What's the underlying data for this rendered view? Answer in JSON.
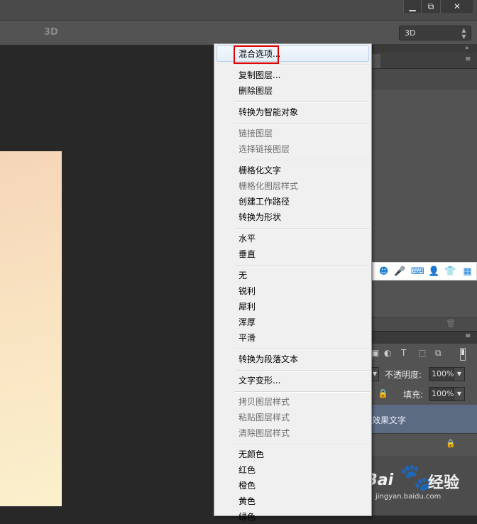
{
  "window": {
    "minimize_label": "▁",
    "restore_label": "⧉",
    "close_label": "✕"
  },
  "options_bar": {
    "mode_3d_label": "3D",
    "select_3d_value": "3D",
    "select_arrows": "▲▼"
  },
  "panels": {
    "collapse_glyph": "»",
    "menu_glyph": "≡",
    "trash_icon": "🗑"
  },
  "ime_toolbar": {
    "icons": [
      "smile-icon",
      "mic-icon",
      "keyboard-icon",
      "user-icon",
      "shirt-icon",
      "grid-icon"
    ]
  },
  "layers": {
    "tool_glyphs": [
      "▣",
      "◐",
      "T",
      "⬚",
      "⧉"
    ],
    "opacity_label": "不透明度:",
    "opacity_value": "100%",
    "fill_label": "填充:",
    "fill_value": "100%",
    "lock_glyph": "🔒",
    "dropdown_arrow": "▼",
    "layer_name": "效果文字"
  },
  "watermark": {
    "brand_left": "Bai",
    "brand_right": "经验",
    "url": "jingyan.baidu.com"
  },
  "context_menu": {
    "items": [
      {
        "label": "混合选项...",
        "enabled": true
      },
      {
        "label": "复制图层...",
        "enabled": true
      },
      {
        "label": "删除图层",
        "enabled": true
      },
      {
        "label": "转换为智能对象",
        "enabled": true
      },
      {
        "label": "链接图层",
        "enabled": false
      },
      {
        "label": "选择链接图层",
        "enabled": false
      },
      {
        "label": "栅格化文字",
        "enabled": true
      },
      {
        "label": "栅格化图层样式",
        "enabled": false
      },
      {
        "label": "创建工作路径",
        "enabled": true
      },
      {
        "label": "转换为形状",
        "enabled": true
      },
      {
        "label": "水平",
        "enabled": true
      },
      {
        "label": "垂直",
        "enabled": true
      },
      {
        "label": "无",
        "enabled": true
      },
      {
        "label": "锐利",
        "enabled": true
      },
      {
        "label": "犀利",
        "enabled": true
      },
      {
        "label": "浑厚",
        "enabled": true
      },
      {
        "label": "平滑",
        "enabled": true
      },
      {
        "label": "转换为段落文本",
        "enabled": true
      },
      {
        "label": "文字变形...",
        "enabled": true
      },
      {
        "label": "拷贝图层样式",
        "enabled": false
      },
      {
        "label": "粘贴图层样式",
        "enabled": false
      },
      {
        "label": "清除图层样式",
        "enabled": false
      },
      {
        "label": "无颜色",
        "enabled": true
      },
      {
        "label": "红色",
        "enabled": true
      },
      {
        "label": "橙色",
        "enabled": true
      },
      {
        "label": "黄色",
        "enabled": true
      },
      {
        "label": "绿色",
        "enabled": true
      }
    ],
    "highlighted_index": 0
  },
  "colors": {
    "accent_highlight_border": "#e00000",
    "selected_layer": "#5b6b82",
    "ime_blue": "#1e7fd4"
  }
}
